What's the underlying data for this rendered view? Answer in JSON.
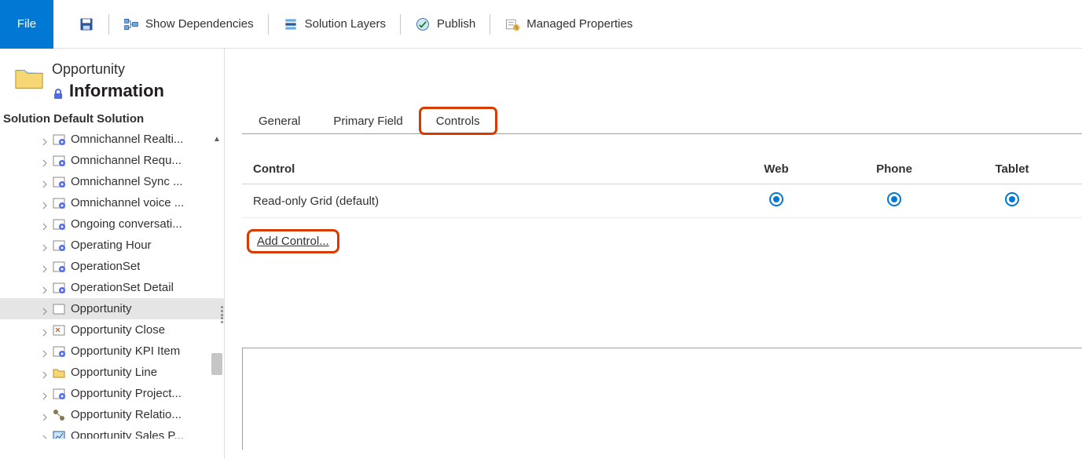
{
  "ribbon": {
    "file_label": "File",
    "items": [
      {
        "id": "save",
        "label": "",
        "icon": "save"
      },
      {
        "id": "deps",
        "label": "Show Dependencies",
        "icon": "dependencies"
      },
      {
        "id": "layers",
        "label": "Solution Layers",
        "icon": "layers"
      },
      {
        "id": "publish",
        "label": "Publish",
        "icon": "publish"
      },
      {
        "id": "managed",
        "label": "Managed Properties",
        "icon": "managed"
      }
    ]
  },
  "left": {
    "entity": "Opportunity",
    "title": "Information",
    "solution_label": "Solution Default Solution",
    "tree_items": [
      {
        "label": "Omnichannel Realti...",
        "icon": "gear",
        "selected": false
      },
      {
        "label": "Omnichannel Requ...",
        "icon": "gear",
        "selected": false
      },
      {
        "label": "Omnichannel Sync ...",
        "icon": "gear",
        "selected": false
      },
      {
        "label": "Omnichannel voice ...",
        "icon": "gear",
        "selected": false
      },
      {
        "label": "Ongoing conversati...",
        "icon": "gear",
        "selected": false
      },
      {
        "label": "Operating Hour",
        "icon": "gear",
        "selected": false
      },
      {
        "label": "OperationSet",
        "icon": "gear",
        "selected": false
      },
      {
        "label": "OperationSet Detail",
        "icon": "gear",
        "selected": false
      },
      {
        "label": "Opportunity",
        "icon": "entity",
        "selected": true
      },
      {
        "label": "Opportunity Close",
        "icon": "close",
        "selected": false
      },
      {
        "label": "Opportunity KPI Item",
        "icon": "gear",
        "selected": false
      },
      {
        "label": "Opportunity Line",
        "icon": "folder",
        "selected": false
      },
      {
        "label": "Opportunity Project...",
        "icon": "gear",
        "selected": false
      },
      {
        "label": "Opportunity Relatio...",
        "icon": "relation",
        "selected": false
      },
      {
        "label": "Opportunity Sales P...",
        "icon": "sales",
        "selected": false
      }
    ]
  },
  "tabs": [
    {
      "label": "General",
      "active": false,
      "highlight": false
    },
    {
      "label": "Primary Field",
      "active": false,
      "highlight": false
    },
    {
      "label": "Controls",
      "active": true,
      "highlight": true
    }
  ],
  "grid": {
    "headers": {
      "control": "Control",
      "web": "Web",
      "phone": "Phone",
      "tablet": "Tablet"
    },
    "rows": [
      {
        "control": "Read-only Grid (default)",
        "web": true,
        "phone": true,
        "tablet": true
      }
    ],
    "add_control_label": "Add Control..."
  }
}
